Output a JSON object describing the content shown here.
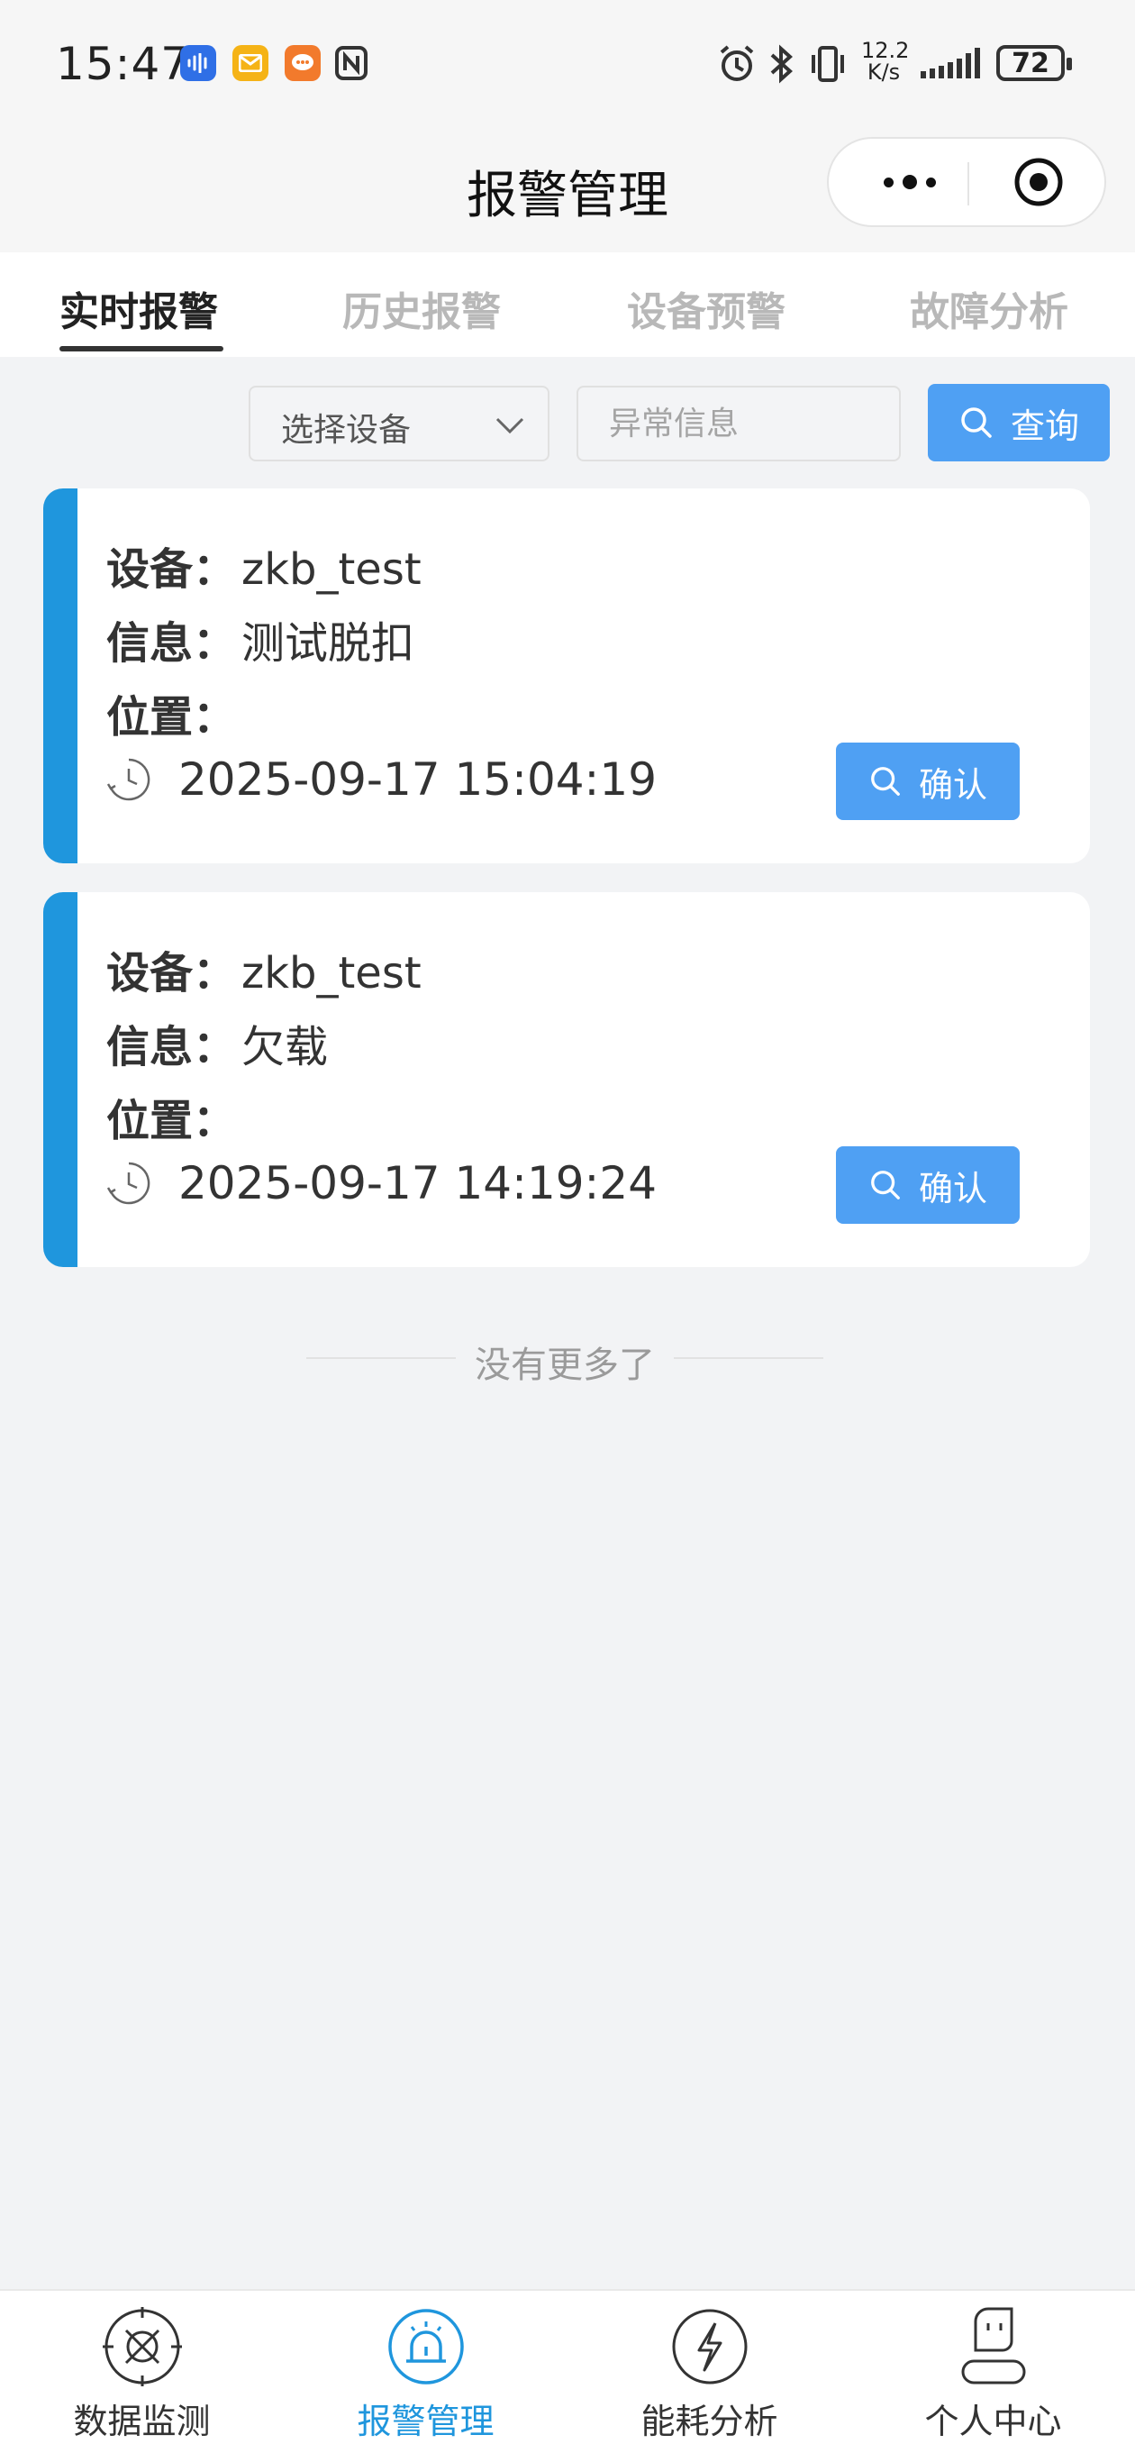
{
  "status_bar": {
    "time": "15:47",
    "net_speed_value": "12.2",
    "net_speed_unit": "K/s",
    "battery": "72"
  },
  "header": {
    "title": "报警管理"
  },
  "tabs": [
    {
      "label": "实时报警",
      "active": true
    },
    {
      "label": "历史报警",
      "active": false
    },
    {
      "label": "设备预警",
      "active": false
    },
    {
      "label": "故障分析",
      "active": false
    }
  ],
  "filter": {
    "device_select_label": "选择设备",
    "info_placeholder": "异常信息",
    "query_label": "查询"
  },
  "labels": {
    "device": "设备：",
    "info": "信息：",
    "location": "位置："
  },
  "alarms": [
    {
      "device": "zkb_test",
      "info": "测试脱扣",
      "location": "",
      "time": "2025-09-17 15:04:19",
      "confirm_label": "确认"
    },
    {
      "device": "zkb_test",
      "info": "欠载",
      "location": "",
      "time": "2025-09-17 14:19:24",
      "confirm_label": "确认"
    }
  ],
  "list_end": "没有更多了",
  "bottom_nav": [
    {
      "label": "数据监测",
      "icon": "monitor-icon",
      "active": false
    },
    {
      "label": "报警管理",
      "icon": "alarm-light-icon",
      "active": true
    },
    {
      "label": "能耗分析",
      "icon": "lightning-icon",
      "active": false
    },
    {
      "label": "个人中心",
      "icon": "user-icon",
      "active": false
    }
  ],
  "colors": {
    "accent": "#1f96dd",
    "button": "#4fa0f3",
    "background": "#f2f3f5"
  }
}
